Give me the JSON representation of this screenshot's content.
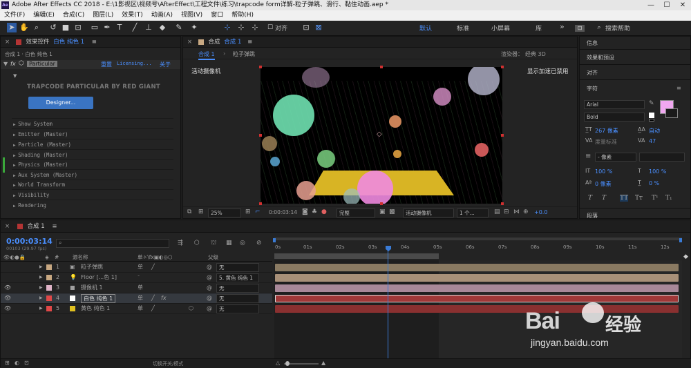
{
  "window": {
    "title": "Adobe After Effects CC 2018 - E:\\1影视区\\视频号\\AfterEffect\\工程文件\\练习\\trapcode form详解-粒子弹跳、滑行、黏住动画.aep *",
    "app_icon": "Ae",
    "min": "—",
    "max": "☐",
    "close": "✕"
  },
  "menu": [
    "文件(F)",
    "编辑(E)",
    "合成(C)",
    "图层(L)",
    "效果(T)",
    "动画(A)",
    "视图(V)",
    "窗口",
    "帮助(H)"
  ],
  "toolbar": {
    "snap_label": "对齐",
    "workspaces": [
      "默认",
      "标准",
      "小屏幕",
      "库"
    ],
    "search_placeholder": "搜索帮助",
    "more": "»"
  },
  "effects_panel": {
    "title": "效果控件",
    "layer": "白色 纯色 1",
    "breadcrumb": "合成 1 · 白色 纯色 1",
    "effect_name": "Particular",
    "reset": "重置",
    "licensing": "Licensing...",
    "about": "关于",
    "brand": "TRAPCODE PARTICULAR BY RED GIANT",
    "designer_btn": "Designer...",
    "properties": [
      "Show System",
      "Emitter (Master)",
      "Particle (Master)",
      "Shading (Master)",
      "Physics (Master)",
      "Aux System (Master)",
      "World Transform",
      "Visibility",
      "Rendering"
    ]
  },
  "viewer": {
    "tab_label": "合成",
    "comp_name": "合成 1",
    "sub_tab": "合成 1",
    "breadcrumb_item": "粒子弹跳",
    "renderer_label": "渲染器：",
    "renderer_value": "经典 3D",
    "camera_label": "活动摄像机",
    "accel_msg": "显示加速已禁用",
    "zoom": "25%",
    "timecode": "0:00:03:14",
    "quality": "完整",
    "camera_dd": "活动摄像机",
    "views_dd": "1 个...",
    "exposure": "+0.0"
  },
  "right_panels": {
    "info": "信息",
    "effects_presets": "效果和预设",
    "align": "对齐",
    "character": "字符",
    "paragraph": "段落",
    "font": "Arial",
    "style": "Bold",
    "font_size": "267 像素",
    "leading": "自动",
    "kerning": "度量标准",
    "tracking": "47",
    "stroke": "- 像素",
    "vscale": "100 %",
    "hscale": "100 %",
    "baseline": "0 像素",
    "tsume": "0 %",
    "fill_color": "#f0a8f0"
  },
  "timeline": {
    "tab": "合成 1",
    "timecode": "0:00:03:14",
    "frames": "00103 (29.97 fps)",
    "search_placeholder": "",
    "col_source": "源名称",
    "col_parent": "父级",
    "toggle_label": "切换开关/模式",
    "ruler": [
      "0s",
      "01s",
      "02s",
      "03s",
      "04s",
      "05s",
      "06s",
      "07s",
      "08s",
      "09s",
      "10s",
      "11s",
      "12s"
    ],
    "layers": [
      {
        "num": "1",
        "name": "粒子弹跳",
        "color": "#c8a882",
        "parent": "无"
      },
      {
        "num": "2",
        "name": "Floor [...色 1]",
        "color": "#c8a882",
        "parent": "5. 黄色 纯色 1"
      },
      {
        "num": "3",
        "name": "摄像机 1",
        "color": "#e0b4c8",
        "parent": "无"
      },
      {
        "num": "4",
        "name": "白色 纯色 1",
        "color": "#e04848",
        "parent": "无"
      },
      {
        "num": "5",
        "name": "黄色 纯色 1",
        "color": "#e04848",
        "parent": "无"
      }
    ],
    "layer_swatches": [
      "#c8a882",
      "#c8a882",
      "#e0b4c8",
      "#ffffff",
      "#e0c020"
    ]
  },
  "watermark": {
    "brand": "Bai",
    "brand_tail": "经验",
    "url": "jingyan.baidu.com"
  }
}
